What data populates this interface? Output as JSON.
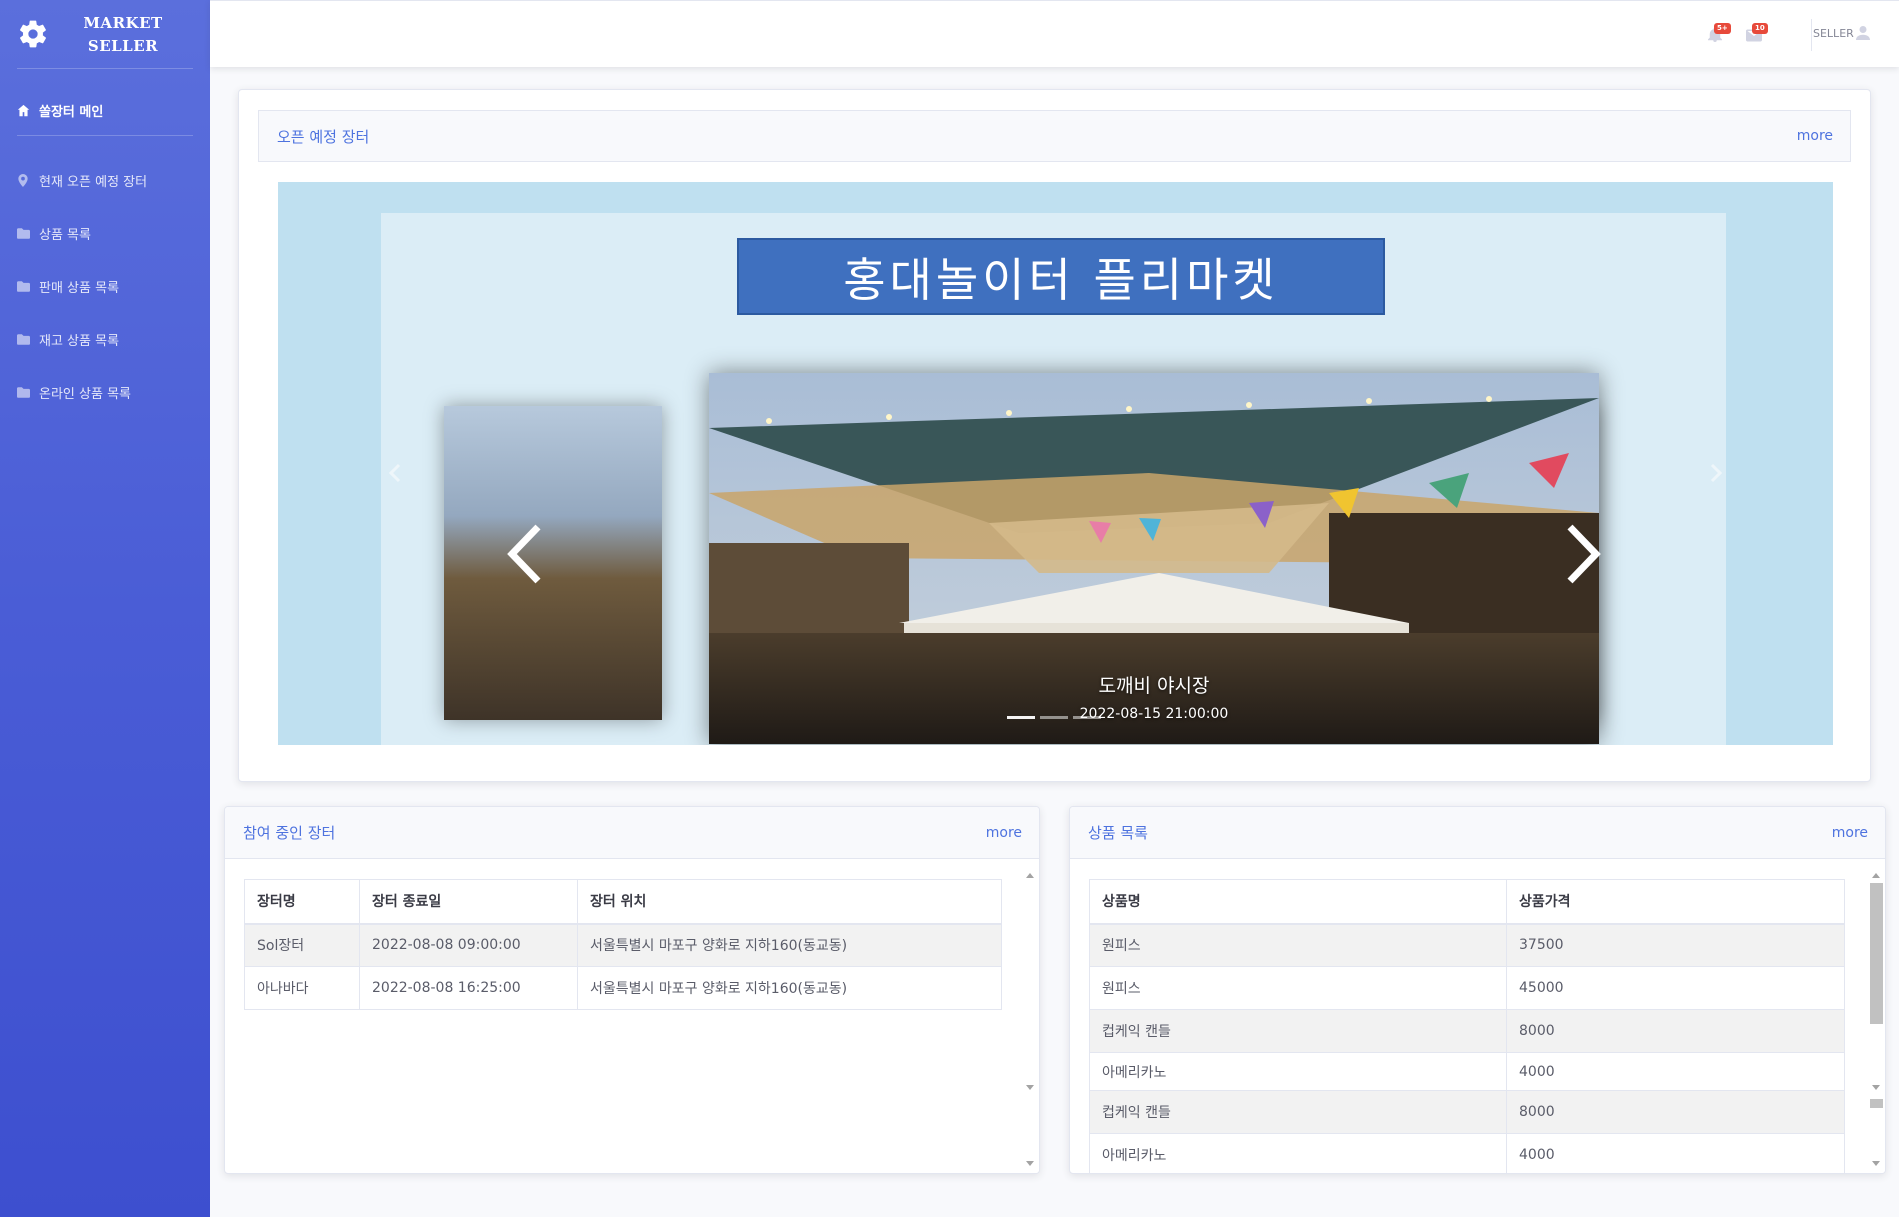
{
  "brand": {
    "line1": "MARKET",
    "line2": "SELLER",
    "icon": "gear-icon"
  },
  "sidebar": {
    "items": [
      {
        "label": "쏠장터 메인",
        "icon": "home-icon",
        "active": true
      },
      {
        "label": "현재 오픈 예정 장터",
        "icon": "map-pin-icon"
      },
      {
        "label": "상품 목록",
        "icon": "folder-icon"
      },
      {
        "label": "판매 상품 목록",
        "icon": "folder-icon"
      },
      {
        "label": "재고 상품 목록",
        "icon": "folder-icon"
      },
      {
        "label": "온라인 상품 목록",
        "icon": "folder-icon"
      }
    ]
  },
  "topbar": {
    "alerts_badge": "5+",
    "messages_badge": "10",
    "user_label": "SELLER"
  },
  "upcoming": {
    "title": "오픈 예정 장터",
    "more": "more",
    "banner": "홍대놀이터 플리마켓",
    "slide_title": "도깨비 야시장",
    "slide_date": "2022-08-15 21:00:00"
  },
  "participating": {
    "title": "참여 중인 장터",
    "more": "more",
    "columns": [
      "장터명",
      "장터 종료일",
      "장터 위치"
    ],
    "rows": [
      [
        "Sol장터",
        "2022-08-08 09:00:00",
        "서울특별시 마포구 양화로 지하160(동교동)"
      ],
      [
        "아나바다",
        "2022-08-08 16:25:00",
        "서울특별시 마포구 양화로 지하160(동교동)"
      ]
    ]
  },
  "products": {
    "title": "상품 목록",
    "more": "more",
    "columns": [
      "상품명",
      "상품가격"
    ],
    "rows": [
      [
        "원피스",
        "37500"
      ],
      [
        "원피스",
        "45000"
      ],
      [
        "컵케익 캔들",
        "8000"
      ],
      [
        "아메리카노",
        "4000"
      ],
      [
        "컵케익 캔들",
        "8000"
      ],
      [
        "아메리카노",
        "4000"
      ]
    ]
  },
  "colors": {
    "sidebar": "#4e5ed8",
    "accent": "#4e73df",
    "badge": "#e74a3b"
  }
}
